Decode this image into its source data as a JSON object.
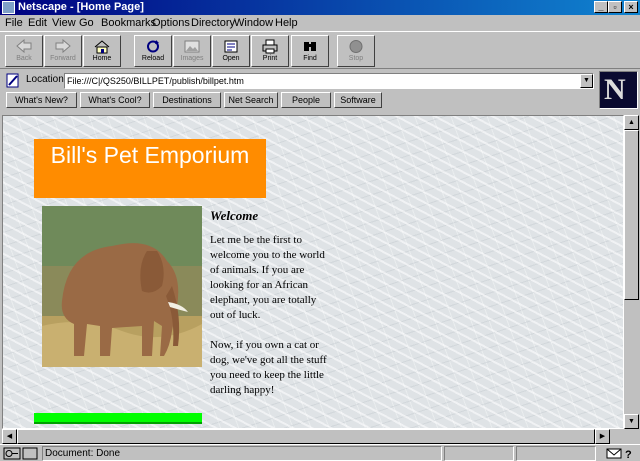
{
  "window": {
    "title": "Netscape - [Home Page]"
  },
  "menu": [
    "File",
    "Edit",
    "View",
    "Go",
    "Bookmarks",
    "Options",
    "Directory",
    "Window",
    "Help"
  ],
  "toolbar": {
    "back": "Back",
    "forward": "Forward",
    "home": "Home",
    "reload": "Reload",
    "images": "Images",
    "open": "Open",
    "print": "Print",
    "find": "Find",
    "stop": "Stop"
  },
  "location": {
    "label": "Location:",
    "url": "File:///C|/QS250/BILLPET/publish/billpet.htm"
  },
  "directory_buttons": [
    "What's New?",
    "What's Cool?",
    "Destinations",
    "Net Search",
    "People",
    "Software"
  ],
  "page": {
    "banner": "Bill's Pet Emporium",
    "heading": "Welcome",
    "paragraph1": "Let me be the first to welcome you to the world of animals. If you are looking for an African elephant, you are totally out of luck.",
    "paragraph2": "Now, if you own a cat or dog, we've got all the stuff you need to keep the little darling happy!"
  },
  "status": {
    "text": "Document: Done"
  },
  "colors": {
    "banner_bg": "#ff8c00",
    "green_bar": "#00ff00",
    "titlebar": "#000080"
  }
}
